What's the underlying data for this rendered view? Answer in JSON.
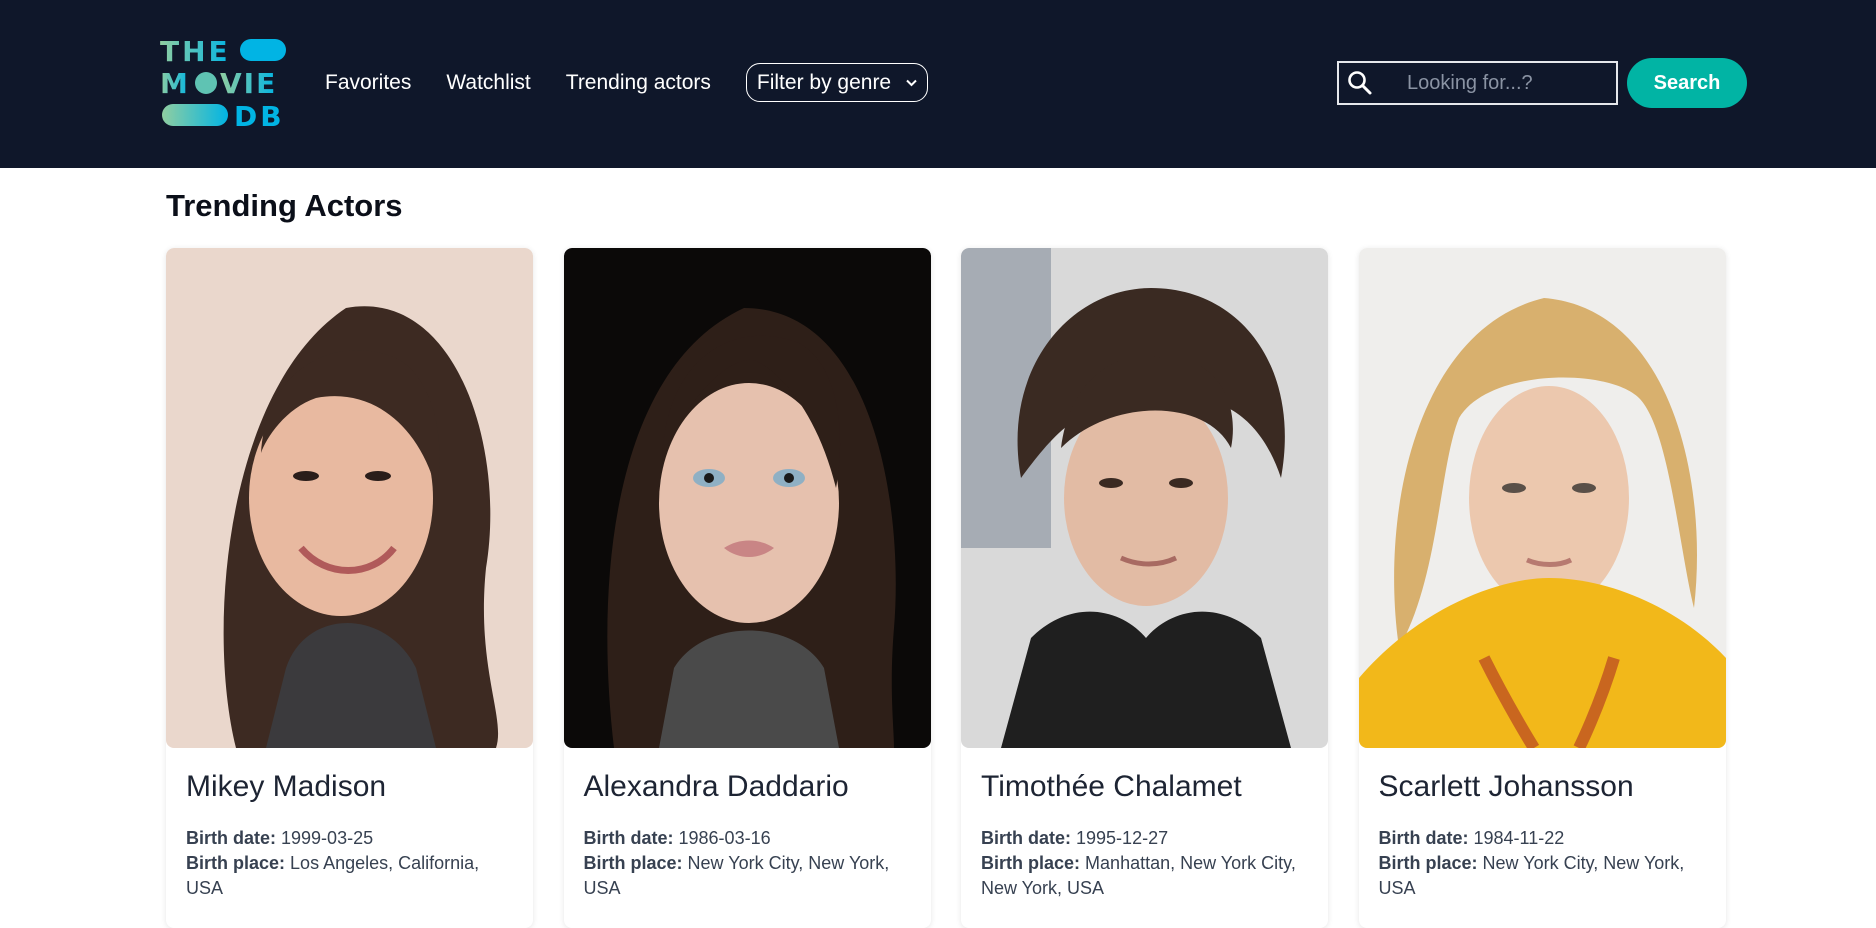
{
  "brand": {
    "logo_lines": [
      "THE",
      "MOVIE",
      "DB"
    ],
    "colors": {
      "gradient_start": "#90cea1",
      "gradient_end": "#01b4e4"
    }
  },
  "nav": {
    "items": [
      {
        "label": "Favorites"
      },
      {
        "label": "Watchlist"
      },
      {
        "label": "Trending actors"
      }
    ],
    "genre_select": {
      "label": "Filter by genre"
    }
  },
  "search": {
    "placeholder": "Looking for...?",
    "value": "",
    "button_label": "Search",
    "icon": "search-icon"
  },
  "main": {
    "title": "Trending Actors",
    "birth_date_label": "Birth date:",
    "birth_place_label": "Birth place:",
    "actors": [
      {
        "name": "Mikey Madison",
        "birth_date": "1999-03-25",
        "birth_place": "Los Angeles, California, USA"
      },
      {
        "name": "Alexandra Daddario",
        "birth_date": "1986-03-16",
        "birth_place": "New York City, New York, USA"
      },
      {
        "name": "Timothée Chalamet",
        "birth_date": "1995-12-27",
        "birth_place": "Manhattan, New York City, New York, USA"
      },
      {
        "name": "Scarlett Johansson",
        "birth_date": "1984-11-22",
        "birth_place": "New York City, New York, USA"
      }
    ]
  },
  "colors": {
    "header_bg": "#0f172a",
    "accent": "#01b4a4"
  }
}
